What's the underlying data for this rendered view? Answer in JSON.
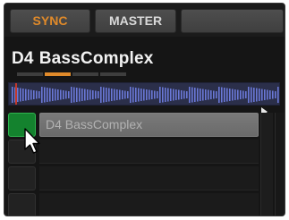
{
  "top_bar": {
    "sync_label": "SYNC",
    "master_label": "MASTER"
  },
  "deck": {
    "key": "D4",
    "name": "BassComplex",
    "page_count": 4,
    "active_page": 2
  },
  "slots": [
    {
      "index": 1,
      "label": "D4 BassComplex",
      "state": "playing"
    },
    {
      "index": 2,
      "label": "",
      "state": "empty"
    },
    {
      "index": 3,
      "label": "",
      "state": "empty"
    },
    {
      "index": 4,
      "label": "",
      "state": "empty"
    }
  ],
  "colors": {
    "sync_accent": "#e08a2a",
    "active_page": "#e08a2a",
    "slot_playing": "#14822e",
    "waveform_bg": "#2b2f4a",
    "waveform_bars": "#6a78d6"
  },
  "icons": {
    "cursor": "mouse-pointer-icon",
    "scroll_indicator": "triangle-right-icon"
  }
}
